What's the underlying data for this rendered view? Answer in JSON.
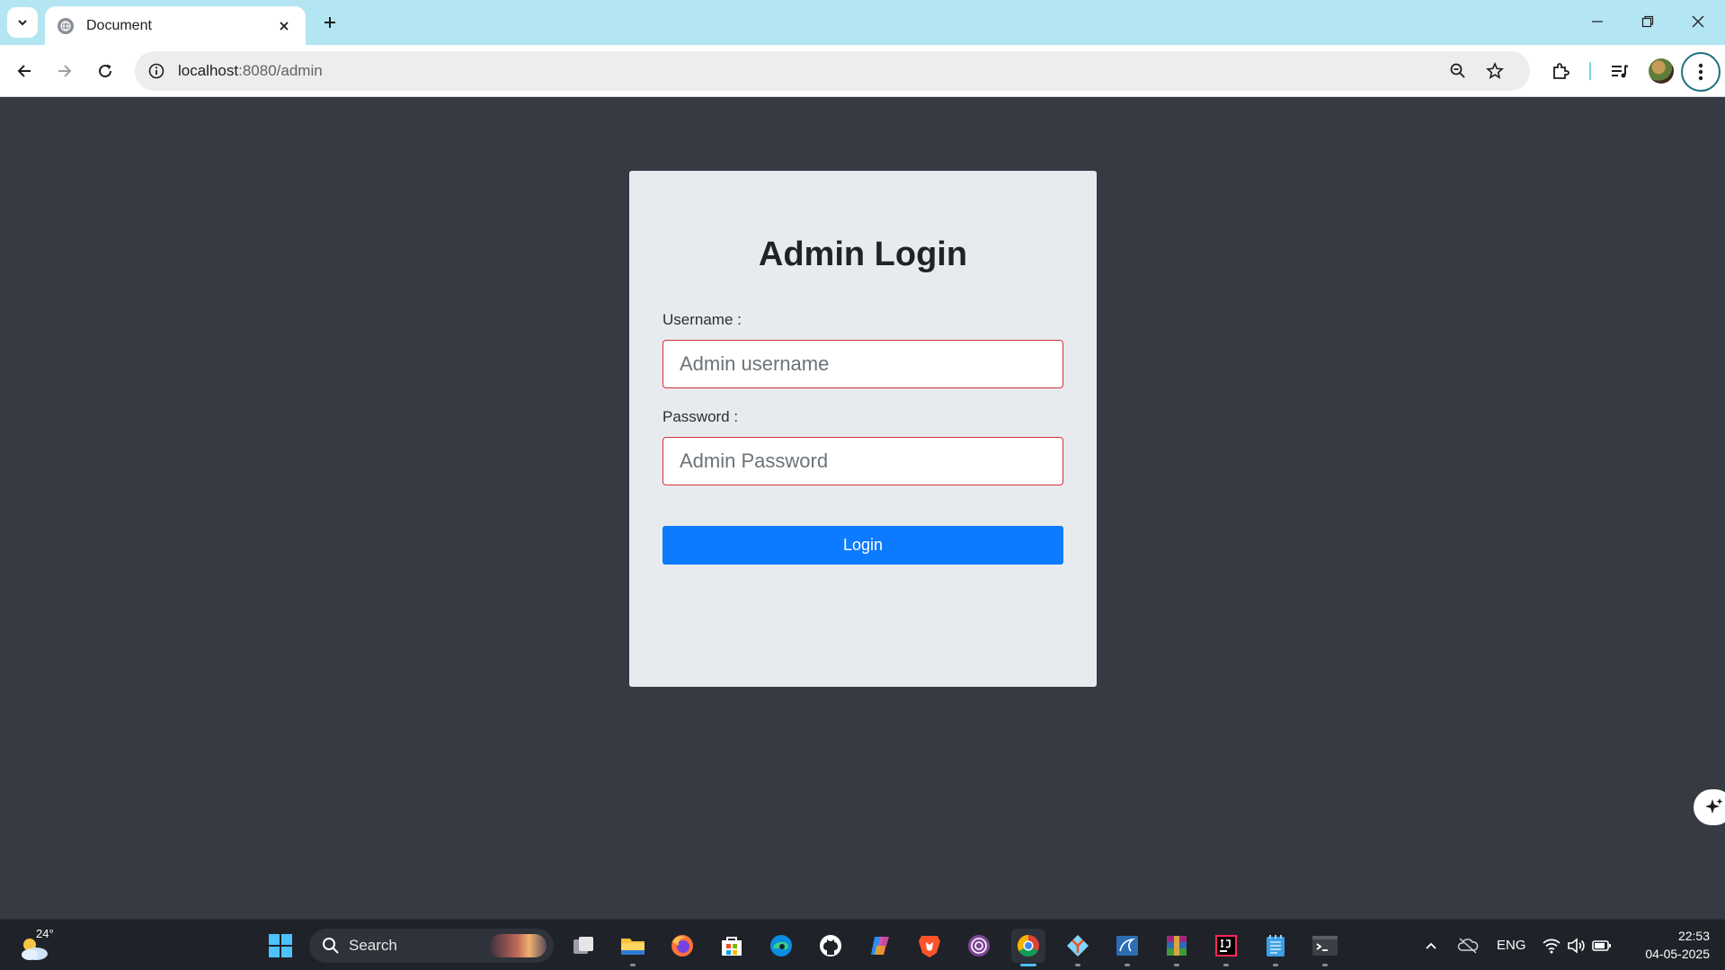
{
  "browser": {
    "tab_title": "Document",
    "url_host": "localhost",
    "url_rest": ":8080/admin"
  },
  "login": {
    "heading": "Admin Login",
    "username_label": "Username :",
    "username_placeholder": "Admin username",
    "password_label": "Password :",
    "password_placeholder": "Admin Password",
    "submit_label": "Login"
  },
  "taskbar": {
    "weather_temp": "24°",
    "search_label": "Search",
    "language": "ENG",
    "time": "22:53",
    "date": "04-05-2025",
    "apps": [
      "task-view",
      "file-explorer",
      "firefox",
      "microsoft-store",
      "edge",
      "github-desktop",
      "copilot",
      "brave",
      "tor-browser",
      "chrome",
      "git",
      "mysql-workbench",
      "winrar",
      "intellij-idea",
      "notepad",
      "terminal"
    ]
  },
  "colors": {
    "page_background": "#353a43",
    "card_background": "#e8ebee",
    "input_border": "#d6303b",
    "button": "#0d7bff",
    "tab_strip": "#b3e5f2"
  }
}
